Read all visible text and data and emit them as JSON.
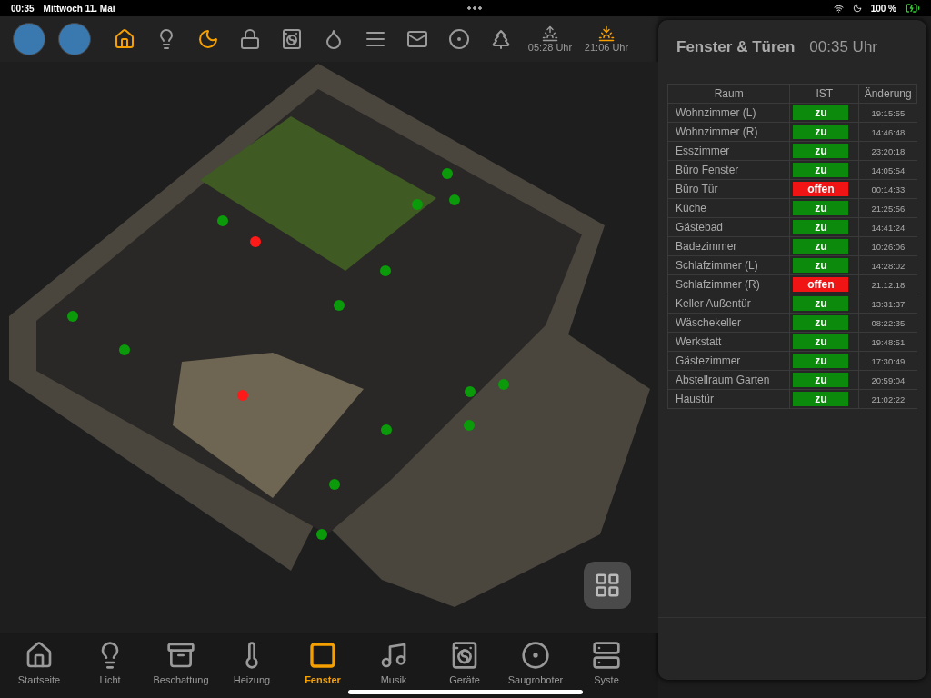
{
  "status_bar": {
    "time": "00:35",
    "date": "Mittwoch 11. Mai",
    "battery": "100 %"
  },
  "top_bar": {
    "items": [
      {
        "on": true
      },
      {
        "on": false
      },
      {
        "on": true
      },
      {
        "on": false
      },
      {
        "on": false
      },
      {
        "on": false
      },
      {
        "on": false
      },
      {
        "on": false
      },
      {
        "on": false
      },
      {
        "on": false
      }
    ],
    "sun": [
      {
        "time": "05:28 Uhr",
        "on": false
      },
      {
        "time": "21:06 Uhr",
        "on": true
      }
    ]
  },
  "floor_plan": {
    "sensors": [
      {
        "color": "#0a9a0a"
      },
      {
        "color": "#0a9a0a"
      },
      {
        "color": "#0a9a0a"
      },
      {
        "color": "#0a9a0a"
      },
      {
        "color": "#ff1a1a"
      },
      {
        "color": "#0a9a0a"
      },
      {
        "color": "#0a9a0a"
      },
      {
        "color": "#0a9a0a"
      },
      {
        "color": "#0a9a0a"
      },
      {
        "color": "#ff1a1a"
      },
      {
        "color": "#0a9a0a"
      },
      {
        "color": "#0a9a0a"
      },
      {
        "color": "#0a9a0a"
      },
      {
        "color": "#0a9a0a"
      },
      {
        "color": "#0a9a0a"
      },
      {
        "color": "#0a9a0a"
      }
    ]
  },
  "panel": {
    "title": "Fenster & Türen",
    "time": "00:35 Uhr",
    "table": {
      "columns": [
        "Raum",
        "IST",
        "Änderung"
      ],
      "rows": [
        {
          "room": "Wohnzimmer (L)",
          "state": "zu",
          "open": false,
          "changed": "19:15:55"
        },
        {
          "room": "Wohnzimmer (R)",
          "state": "zu",
          "open": false,
          "changed": "14:46:48"
        },
        {
          "room": "Esszimmer",
          "state": "zu",
          "open": false,
          "changed": "23:20:18"
        },
        {
          "room": "Büro Fenster",
          "state": "zu",
          "open": false,
          "changed": "14:05:54"
        },
        {
          "room": "Büro Tür",
          "state": "offen",
          "open": true,
          "changed": "00:14:33"
        },
        {
          "room": "Küche",
          "state": "zu",
          "open": false,
          "changed": "21:25:56"
        },
        {
          "room": "Gästebad",
          "state": "zu",
          "open": false,
          "changed": "14:41:24"
        },
        {
          "room": "Badezimmer",
          "state": "zu",
          "open": false,
          "changed": "10:26:06"
        },
        {
          "room": "Schlafzimmer (L)",
          "state": "zu",
          "open": false,
          "changed": "14:28:02"
        },
        {
          "room": "Schlafzimmer (R)",
          "state": "offen",
          "open": true,
          "changed": "21:12:18"
        },
        {
          "room": "Keller Außentür",
          "state": "zu",
          "open": false,
          "changed": "13:31:37"
        },
        {
          "room": "Wäschekeller",
          "state": "zu",
          "open": false,
          "changed": "08:22:35"
        },
        {
          "room": "Werkstatt",
          "state": "zu",
          "open": false,
          "changed": "19:48:51"
        },
        {
          "room": "Gästezimmer",
          "state": "zu",
          "open": false,
          "changed": "17:30:49"
        },
        {
          "room": "Abstellraum Garten",
          "state": "zu",
          "open": false,
          "changed": "20:59:04"
        },
        {
          "room": "Haustür",
          "state": "zu",
          "open": false,
          "changed": "21:02:22"
        }
      ]
    }
  },
  "bottom_nav": [
    {
      "label": "Startseite",
      "selected": false
    },
    {
      "label": "Licht",
      "selected": false
    },
    {
      "label": "Beschattung",
      "selected": false
    },
    {
      "label": "Heizung",
      "selected": false
    },
    {
      "label": "Fenster",
      "selected": true
    },
    {
      "label": "Musik",
      "selected": false
    },
    {
      "label": "Geräte",
      "selected": false
    },
    {
      "label": "Saugroboter",
      "selected": false
    },
    {
      "label": "Syste",
      "selected": false
    }
  ]
}
